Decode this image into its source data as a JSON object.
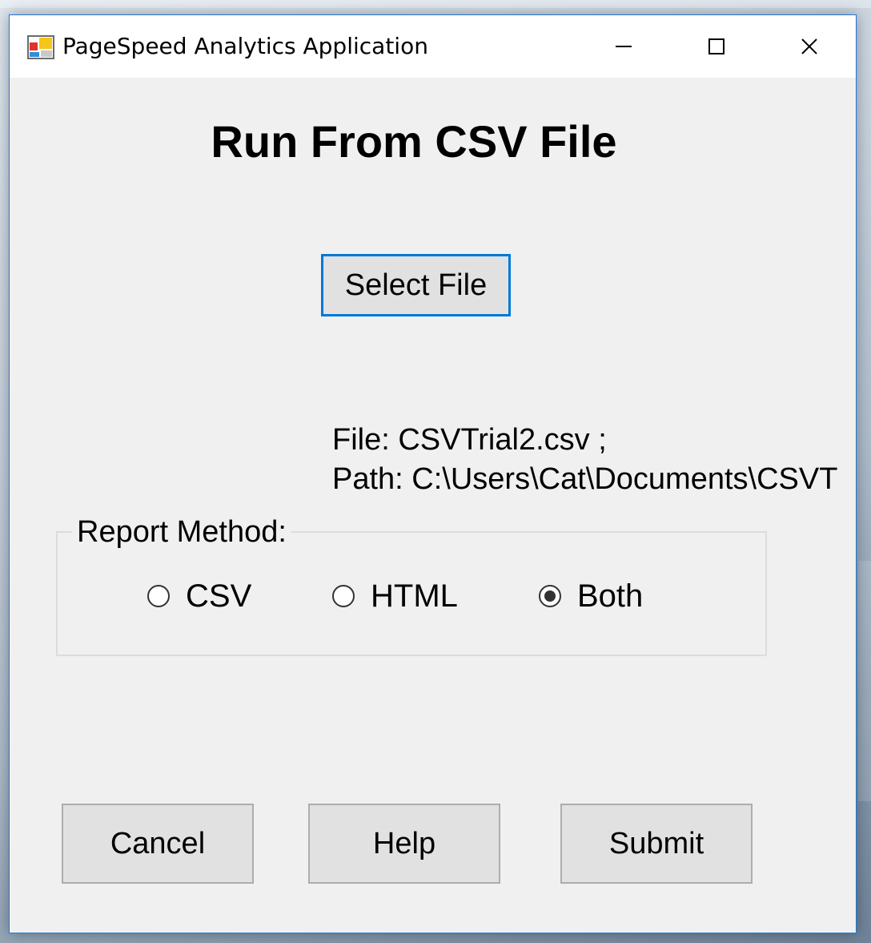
{
  "window": {
    "title": "PageSpeed Analytics Application",
    "minimize_icon": "minimize-icon",
    "maximize_icon": "maximize-icon",
    "close_icon": "close-icon"
  },
  "main": {
    "heading": "Run From CSV File",
    "select_file_label": "Select File",
    "file_line": "File: CSVTrial2.csv ;",
    "path_line": "Path: C:\\Users\\Cat\\Documents\\CSVT"
  },
  "report_method": {
    "label": "Report Method:",
    "options": [
      {
        "label": "CSV",
        "selected": false
      },
      {
        "label": "HTML",
        "selected": false
      },
      {
        "label": "Both",
        "selected": true
      }
    ]
  },
  "actions": {
    "cancel_label": "Cancel",
    "help_label": "Help",
    "submit_label": "Submit"
  },
  "colors": {
    "accent": "#0078d7",
    "button_bg": "#e1e1e1",
    "window_bg": "#f0f0f0"
  }
}
